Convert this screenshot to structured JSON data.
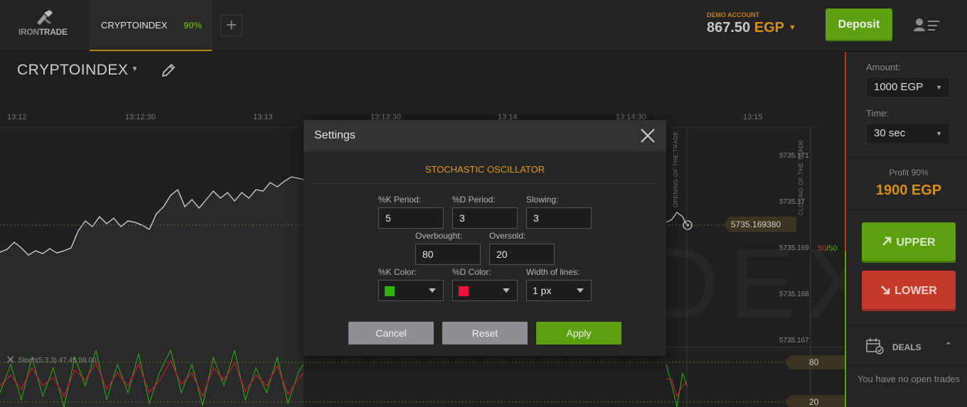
{
  "header": {
    "logo_text_a": "IRON",
    "logo_text_b": "TRADE",
    "asset_tab": {
      "name": "CRYPTOINDEX",
      "payout": "90%"
    },
    "add_tab_symbol": "+",
    "account": {
      "label": "DEMO ACCOUNT",
      "balance": "867.50",
      "currency": "EGP"
    },
    "deposit_label": "Deposit"
  },
  "chart": {
    "asset_title": "CRYPTOINDEX",
    "watermark": "CRYPTOINDEX",
    "time_labels": [
      "13:12",
      "13:12:30",
      "13:13",
      "13:13:30",
      "13:14",
      "13:14:30",
      "13:15"
    ],
    "price_labels": [
      "5735.171",
      "5735.17",
      "5735.169",
      "5735.168",
      "5735.167"
    ],
    "current_price": "5735.169380",
    "ratio_red": "50",
    "ratio_sep": "/",
    "ratio_green": "50",
    "opening_label": "OPENING OF THE TRADE",
    "closing_label": "CLOSING OF THE TRADE",
    "stoch_label": "Stoch(5,3,3) 47.45 59.00",
    "level_high": "80",
    "level_low": "20"
  },
  "panel": {
    "amount_label": "Amount:",
    "amount_value": "1000 EGP",
    "time_label": "Time:",
    "time_value": "30 sec",
    "profit_label": "Profit 90%",
    "profit_value": "1900 EGP",
    "upper_label": "UPPER",
    "lower_label": "LOWER",
    "deals_label": "DEALS",
    "no_trades": "You have no open trades"
  },
  "modal": {
    "title": "Settings",
    "indicator": "STOCHASTIC OSCILLATOR",
    "k_period_label": "%K Period:",
    "k_period": "5",
    "d_period_label": "%D Period:",
    "d_period": "3",
    "slowing_label": "Slowing:",
    "slowing": "3",
    "overbought_label": "Overbought:",
    "overbought": "80",
    "oversold_label": "Oversold:",
    "oversold": "20",
    "k_color_label": "%K Color:",
    "k_color": "#2db40e",
    "d_color_label": "%D Color:",
    "d_color": "#f0103c",
    "width_label": "Width of lines:",
    "width_value": "1 px",
    "cancel_label": "Cancel",
    "reset_label": "Reset",
    "apply_label": "Apply"
  },
  "colors": {
    "accent_orange": "#d88f16",
    "green": "#5ba10f",
    "red": "#c43a2a"
  }
}
